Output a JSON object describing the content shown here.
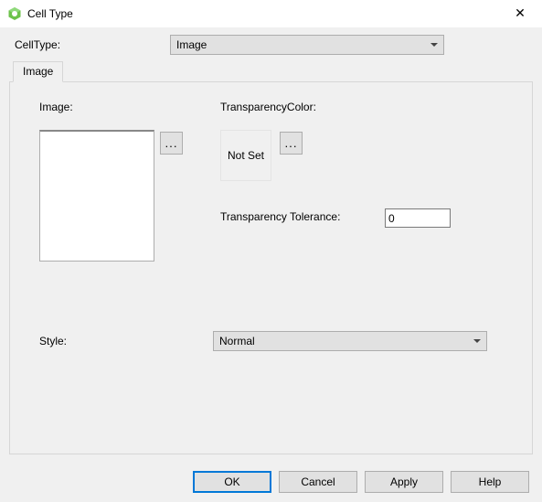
{
  "window": {
    "title": "Cell Type",
    "close_glyph": "✕"
  },
  "celltype": {
    "label": "CellType:",
    "value": "Image"
  },
  "tabs": {
    "image_label": "Image"
  },
  "panel": {
    "image_label": "Image:",
    "browse_label": "...",
    "tc_label": "TransparencyColor:",
    "tc_value": "Not Set",
    "tc_browse_label": "...",
    "tt_label": "Transparency Tolerance:",
    "tt_value": "0",
    "style_label": "Style:",
    "style_value": "Normal"
  },
  "buttons": {
    "ok": "OK",
    "cancel": "Cancel",
    "apply": "Apply",
    "help": "Help"
  }
}
